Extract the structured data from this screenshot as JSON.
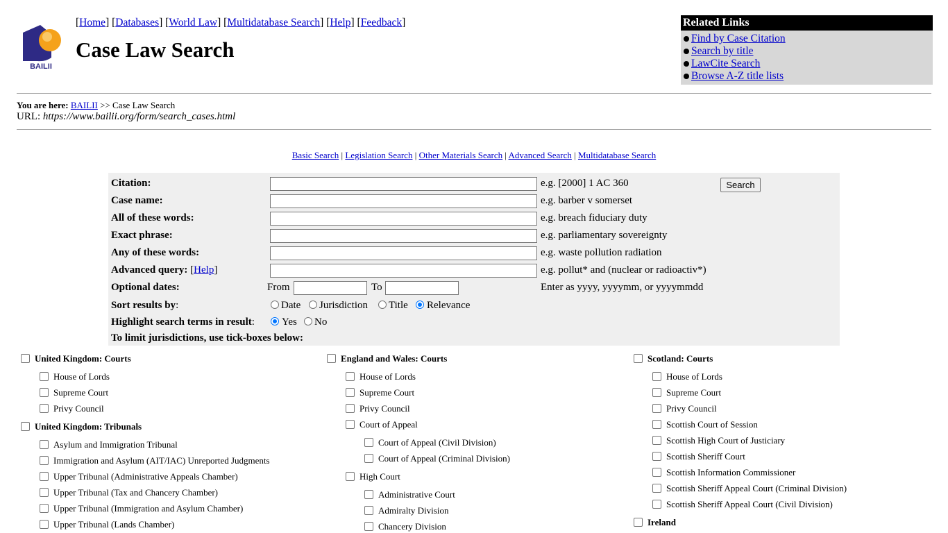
{
  "logo": {
    "text": "BAILII",
    "colors": {
      "purple": "#2e2a85",
      "orange": "#f5a21b"
    }
  },
  "topnav": {
    "items": [
      "Home",
      "Databases",
      "World Law",
      "Multidatabase Search",
      "Help",
      "Feedback"
    ]
  },
  "page_title": "Case Law Search",
  "related_links": {
    "heading": "Related Links",
    "items": [
      "Find by Case Citation",
      "Search by title",
      "LawCite Search",
      "Browse A-Z title lists"
    ]
  },
  "breadcrumb": {
    "prefix": "You are here:",
    "root": "BAILII",
    "sep": ">>",
    "current": "Case Law Search"
  },
  "url": {
    "label": "URL",
    "value": "https://www.bailii.org/form/search_cases.html"
  },
  "subnav": {
    "items": [
      "Basic Search",
      "Legislation Search",
      "Other Materials Search",
      "Advanced Search",
      "Multidatabase Search"
    ]
  },
  "form": {
    "fields": [
      {
        "label": "Citation:",
        "example": "e.g. [2000] 1 AC 360",
        "value": ""
      },
      {
        "label": "Case name:",
        "example": "e.g. barber v somerset",
        "value": ""
      },
      {
        "label": "All of these words:",
        "example": "e.g. breach fiduciary duty",
        "value": ""
      },
      {
        "label": "Exact phrase:",
        "example": "e.g. parliamentary sovereignty",
        "value": ""
      },
      {
        "label": "Any of these words:",
        "example": "e.g. waste pollution radiation",
        "value": ""
      },
      {
        "label": "Advanced query:",
        "help": "Help",
        "example": "e.g. pollut* and (nuclear or radioactiv*)",
        "value": ""
      }
    ],
    "search_button": "Search",
    "dates": {
      "label": "Optional dates:",
      "from": "From",
      "to": "To",
      "hint": "Enter as yyyy, yyyymm, or yyyymmdd"
    },
    "sort": {
      "label": "Sort results by",
      "options": [
        "Date",
        "Jurisdiction",
        "Title",
        "Relevance"
      ],
      "selected": "Relevance"
    },
    "highlight": {
      "label": "Highlight search terms in result",
      "options": [
        "Yes",
        "No"
      ],
      "selected": "Yes"
    },
    "limit_note": "To limit jurisdictions, use tick-boxes below:"
  },
  "jurisdictions": {
    "col1": {
      "uk_courts": {
        "title": "United Kingdom: Courts",
        "items": [
          "House of Lords",
          "Supreme Court",
          "Privy Council"
        ]
      },
      "uk_tribunals": {
        "title": "United Kingdom: Tribunals",
        "items": [
          "Asylum and Immigration Tribunal",
          "Immigration and Asylum (AIT/IAC) Unreported Judgments",
          "Upper Tribunal (Administrative Appeals Chamber)",
          "Upper Tribunal (Tax and Chancery Chamber)",
          "Upper Tribunal (Immigration and Asylum Chamber)",
          "Upper Tribunal (Lands Chamber)"
        ]
      }
    },
    "col2": {
      "title": "England and Wales: Courts",
      "items": [
        "House of Lords",
        "Supreme Court",
        "Privy Council",
        "Court of Appeal"
      ],
      "coa_sub": [
        "Court of Appeal (Civil Division)",
        "Court of Appeal (Criminal Division)"
      ],
      "high_court": "High Court",
      "hc_sub": [
        "Administrative Court",
        "Admiralty Division",
        "Chancery Division"
      ]
    },
    "col3": {
      "title": "Scotland: Courts",
      "items": [
        "House of Lords",
        "Supreme Court",
        "Privy Council",
        "Scottish Court of Session",
        "Scottish High Court of Justiciary",
        "Scottish Sheriff Court",
        "Scottish Information Commissioner",
        "Scottish Sheriff Appeal Court (Criminal Division)",
        "Scottish Sheriff Appeal Court (Civil Division)"
      ],
      "ireland": "Ireland"
    }
  }
}
